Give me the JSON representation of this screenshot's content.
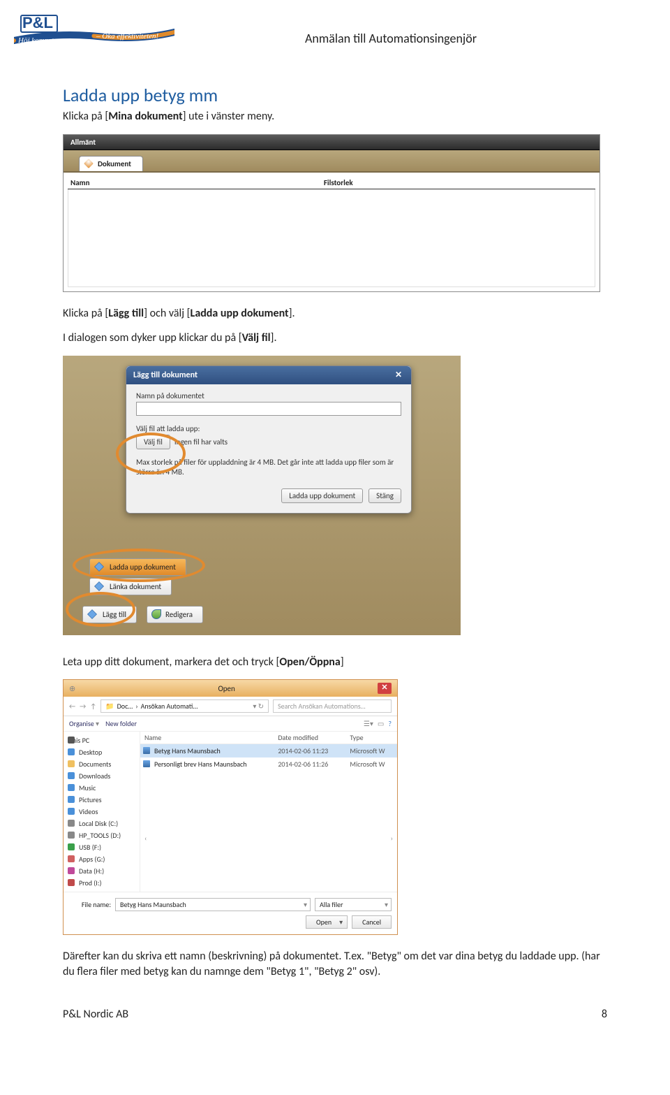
{
  "doc": {
    "header_title": "Anmälan till Automationsingenjör",
    "section_heading": "Ladda upp betyg mm",
    "para1_a": "Klicka på [",
    "para1_b": "Mina dokument",
    "para1_c": "] ute i vänster meny.",
    "para2_a": "Klicka på [",
    "para2_b": "Lägg till",
    "para2_c": "] och välj [",
    "para2_d": "Ladda upp dokument",
    "para2_e": "].",
    "para3_a": "I dialogen som dyker upp klickar du på [",
    "para3_b": "Välj fil",
    "para3_c": "].",
    "para4_a": "Leta upp ditt dokument, markera det och tryck [",
    "para4_b": "Open/Öppna",
    "para4_c": "]",
    "para5": "Därefter kan du skriva ett namn (beskrivning) på dokumentet. T.ex. \"Betyg\" om det var dina betyg du laddade upp. (har du flera filer med betyg kan du namnge dem \"Betyg 1\", \"Betyg 2\" osv).",
    "footer_left": "P&L Nordic AB",
    "footer_right": "8",
    "logo_top": "P&L",
    "logo_ribbon_left": "Höj kompetensen",
    "logo_ribbon_right": "– Öka effektiviteten!"
  },
  "shot1": {
    "topbar": "Allmänt",
    "tab": "Dokument",
    "col_name": "Namn",
    "col_size": "Filstorlek"
  },
  "modal": {
    "title": "Lägg till dokument",
    "name_label": "Namn på dokumentet",
    "choose_label": "Välj fil att ladda upp:",
    "choose_btn": "Välj fil",
    "no_file": "Ingen fil har valts",
    "note": "Max storlek på filer för uppladdning är 4 MB. Det går inte att ladda upp filer som är större än 4 MB.",
    "upload_btn": "Ladda upp dokument",
    "close_btn": "Stäng"
  },
  "menu": {
    "upload": "Ladda upp dokument",
    "link": "Länka dokument",
    "add": "Lägg till",
    "edit": "Redigera"
  },
  "dialog": {
    "title": "Open",
    "crumb1": "Doc…",
    "crumb2": "Ansökan Automati…",
    "search_ph": "Search Ansökan Automations…",
    "organise": "Organise",
    "newfolder": "New folder",
    "col_name": "Name",
    "col_date": "Date modified",
    "col_type": "Type",
    "side_pc": "This PC",
    "side": [
      "Desktop",
      "Documents",
      "Downloads",
      "Music",
      "Pictures",
      "Videos",
      "Local Disk (C:)",
      "HP_TOOLS (D:)",
      "USB (F:)",
      "Apps (G:)",
      "Data (H:)",
      "Prod (I:)"
    ],
    "files": [
      {
        "name": "Betyg Hans Maunsbach",
        "date": "2014-02-06 11:23",
        "type": "Microsoft W"
      },
      {
        "name": "Personligt brev Hans Maunsbach",
        "date": "2014-02-06 11:26",
        "type": "Microsoft W"
      }
    ],
    "filename_label": "File name:",
    "filename_value": "Betyg Hans Maunsbach",
    "filter": "Alla filer",
    "open": "Open",
    "cancel": "Cancel"
  }
}
